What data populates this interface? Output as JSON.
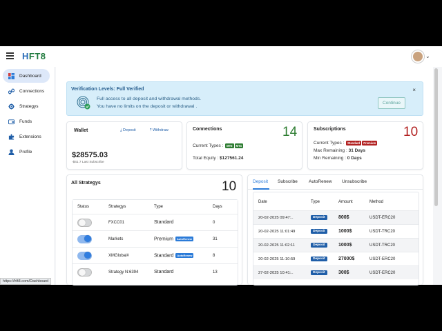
{
  "app": {
    "logo_prefix": "H",
    "logo_text": "FT8"
  },
  "status_url": "https://hft8.com/Dashboard",
  "sidebar": {
    "items": [
      {
        "label": "Dashboard",
        "icon": "dashboard-icon"
      },
      {
        "label": "Connections",
        "icon": "link-icon"
      },
      {
        "label": "Strategys",
        "icon": "gear-icon"
      },
      {
        "label": "Funds",
        "icon": "wallet-icon"
      },
      {
        "label": "Extensions",
        "icon": "puzzle-icon"
      },
      {
        "label": "Profile",
        "icon": "user-icon"
      }
    ]
  },
  "verification": {
    "title": "Verification Levels: Full Verified",
    "line1": "Full access to all deposit and withdrawal methods.",
    "line2": "You have no limits on the deposit or withdrawal .",
    "button": "Continue",
    "close": "×"
  },
  "wallet": {
    "title": "Wallet",
    "deposit_label": "Deposit",
    "withdraw_label": "Withdraw",
    "amount": "$28575.03",
    "sub": "-$41.7 Last Subscribe"
  },
  "connections": {
    "title": "Connections",
    "count": "14",
    "types_label": "Current Types :",
    "type1": "MT5",
    "type2": "MT4",
    "equity_label": "Total Equity :",
    "equity_value": "$127561.24"
  },
  "subscriptions": {
    "title": "Subscriptions",
    "count": "10",
    "types_label": "Current Types :",
    "type1": "Standard",
    "type2": "Premium",
    "max_label": "Max Remaining :",
    "max_value": "31 Days",
    "min_label": "Min Remaining :",
    "min_value": "0 Days"
  },
  "strategies": {
    "title": "All Strategys",
    "count": "10",
    "headers": [
      "Status",
      "Strategys",
      "Type",
      "Days"
    ],
    "autorenew": "AutoRenew",
    "rows": [
      {
        "on": false,
        "name": "FXCC01",
        "type": "Standard",
        "auto": false,
        "days": "0"
      },
      {
        "on": true,
        "name": "Markets",
        "type": "Premium",
        "auto": true,
        "days": "31"
      },
      {
        "on": true,
        "name": "XMGlobal#",
        "type": "Standard",
        "auto": true,
        "days": "8"
      },
      {
        "on": false,
        "name": "Strategy N:6394",
        "type": "Standard",
        "auto": false,
        "days": "13"
      }
    ]
  },
  "transactions": {
    "tabs": [
      "Deposit",
      "Subscribe",
      "AutoRenew",
      "Unsubscribe"
    ],
    "headers": [
      "Date",
      "Type",
      "Amount",
      "Method"
    ],
    "rows": [
      {
        "date": "20-02-2025 09:47:..",
        "type": "Deposit",
        "amount": "800$",
        "method": "USDT-ERC20"
      },
      {
        "date": "20-02-2025 11:01:49",
        "type": "Deposit",
        "amount": "1000$",
        "method": "USDT-TRC20"
      },
      {
        "date": "20-02-2025 11:02:11",
        "type": "Deposit",
        "amount": "1000$",
        "method": "USDT-TRC20"
      },
      {
        "date": "20-02-2025 11:10:59",
        "type": "Deposit",
        "amount": "27000$",
        "method": "USDT-ERC20"
      },
      {
        "date": "27-02-2025 10:41:..",
        "type": "Deposit",
        "amount": "300$",
        "method": "USDT-ERC20"
      }
    ]
  },
  "colors": {
    "accent": "#2b7bd8",
    "connections_count": "#2e7d32",
    "subscriptions_count": "#b22222",
    "verify_bg": "#d7eefa"
  }
}
